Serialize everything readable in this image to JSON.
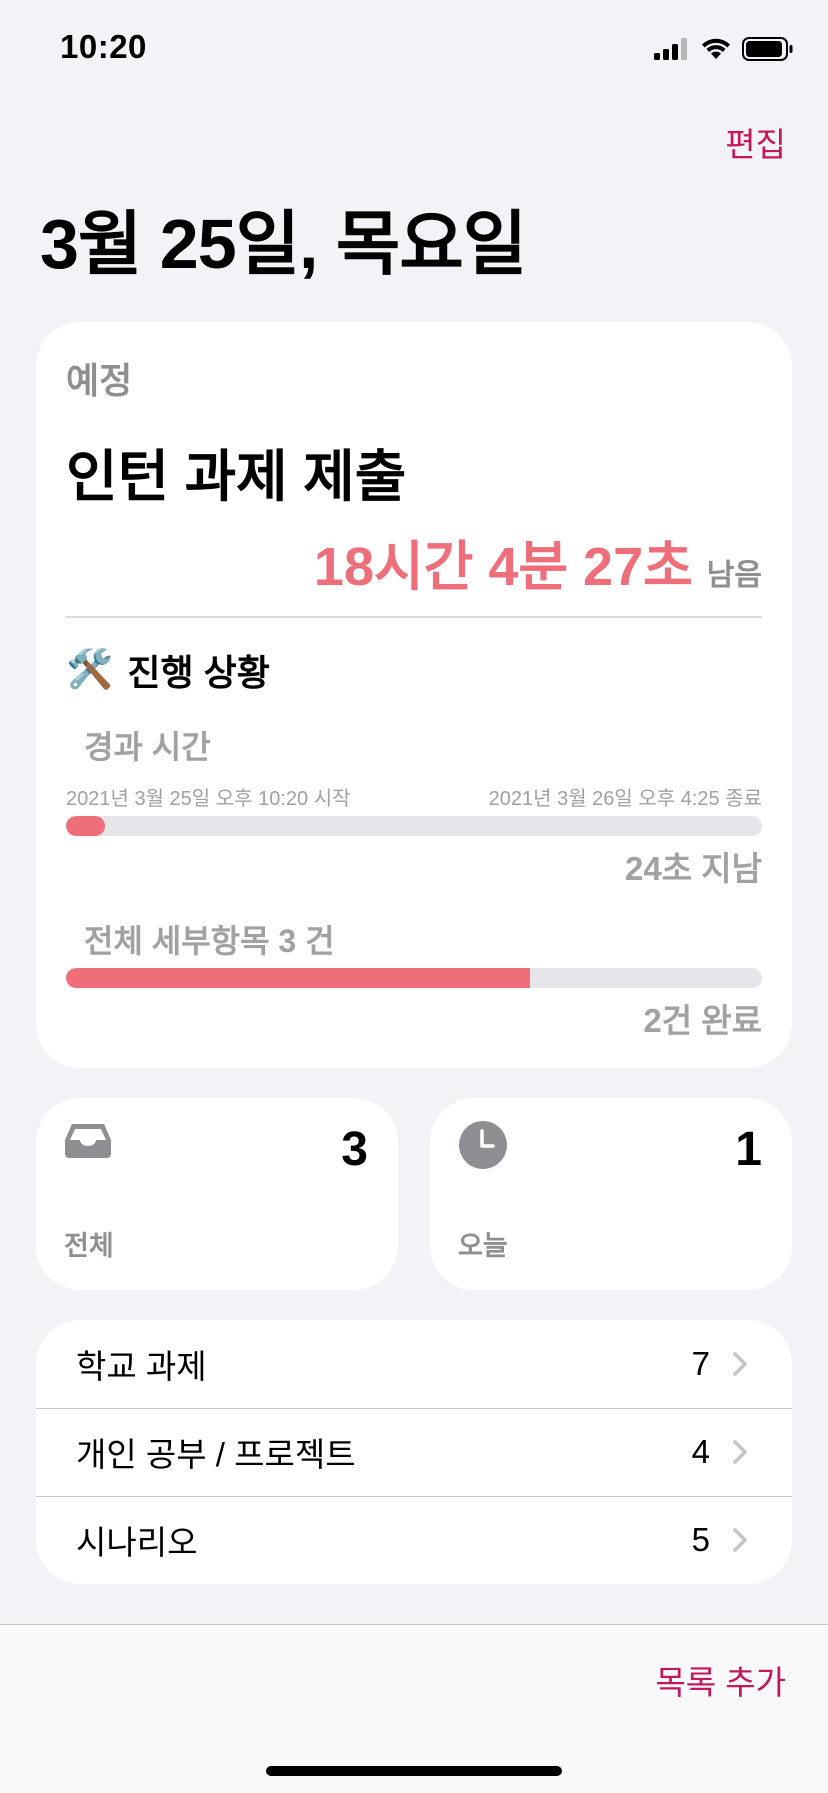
{
  "status_bar": {
    "time": "10:20"
  },
  "header": {
    "edit_label": "편집",
    "date_title": "3월 25일, 목요일"
  },
  "main_card": {
    "section_label": "예정",
    "task_title": "인턴 과제 제출",
    "remaining_time": "18시간 4분 27초",
    "remaining_suffix": "남음",
    "progress_heading": "진행 상황",
    "progress_emoji": "🛠️",
    "elapsed": {
      "label": "경과 시간",
      "start": "2021년 3월 25일 오후 10:20 시작",
      "end": "2021년 3월 26일 오후 4:25 종료",
      "fraction": 0.056,
      "note_value": "24",
      "note_suffix": "초 지남"
    },
    "subtasks": {
      "label_prefix": "전체 세부항목",
      "total": "3",
      "label_suffix": "건",
      "fraction": 0.667,
      "done_value": "2",
      "done_suffix": "건 완료"
    }
  },
  "summary_cards": {
    "all": {
      "label": "전체",
      "count": "3",
      "icon": "tray-icon"
    },
    "today": {
      "label": "오늘",
      "count": "1",
      "icon": "clock-icon"
    }
  },
  "lists": [
    {
      "name": "학교 과제",
      "count": "7"
    },
    {
      "name": "개인 공부 / 프로젝트",
      "count": "4"
    },
    {
      "name": "시나리오",
      "count": "5"
    }
  ],
  "bottom_bar": {
    "add_list_label": "목록 추가"
  },
  "colors": {
    "accent": "#c2185b",
    "progress": "#ee6e7a",
    "secondary_text": "#8e8e93",
    "background": "#f2f2f7"
  }
}
